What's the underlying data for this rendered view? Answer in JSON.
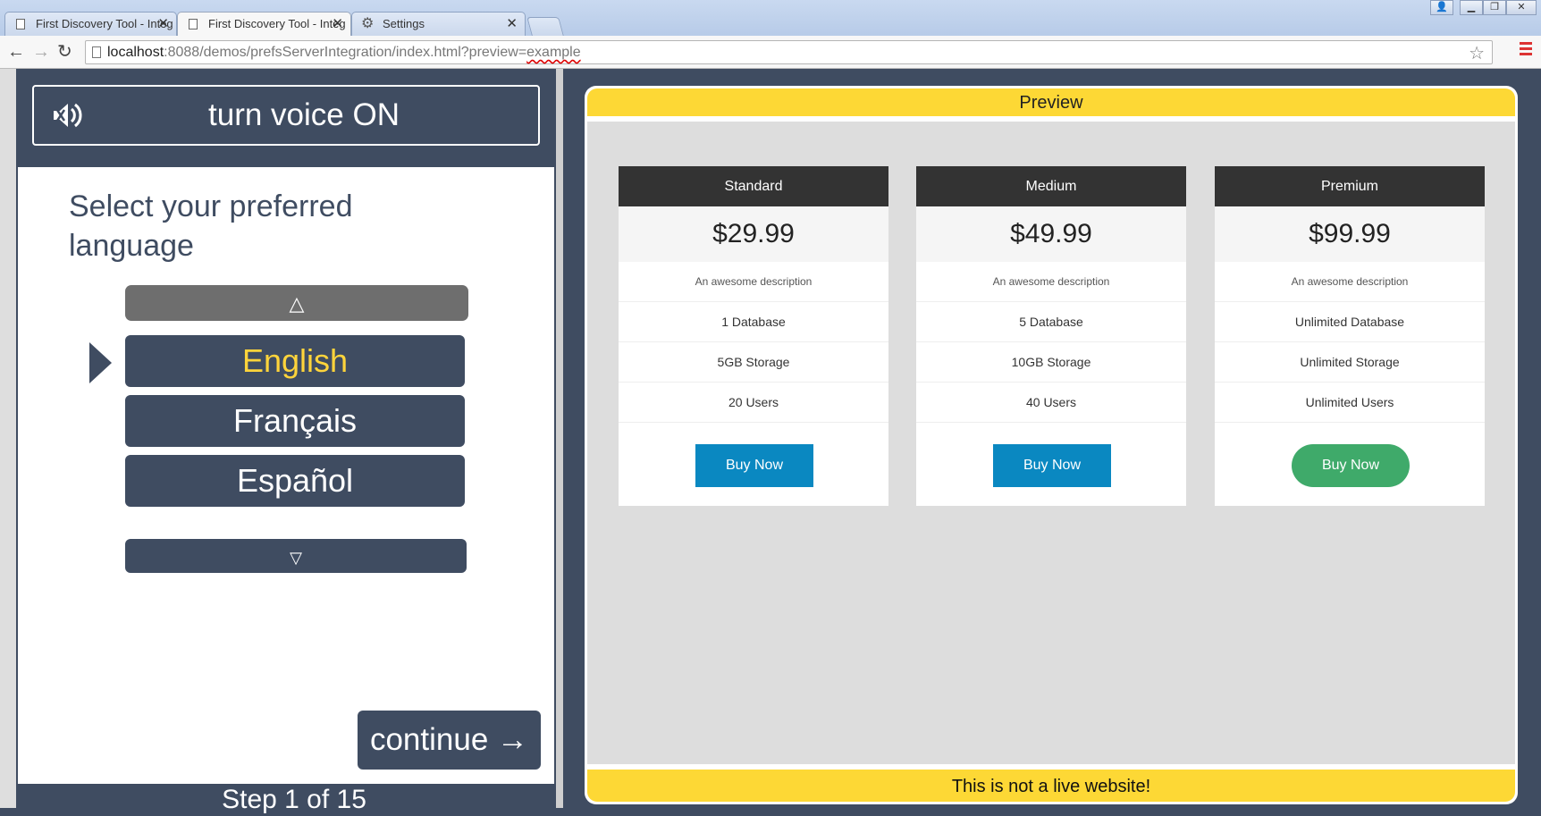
{
  "browser": {
    "tabs": [
      {
        "title": "First Discovery Tool - Integ"
      },
      {
        "title": "First Discovery Tool - Integ"
      },
      {
        "title": "Settings"
      }
    ],
    "url": {
      "host": "localhost",
      "path": ":8088/demos/prefsServerIntegration/index.html?preview=",
      "query": "example"
    }
  },
  "tool": {
    "voice_button": "turn voice ON",
    "prompt": "Select your preferred language",
    "scroll_up": "△",
    "scroll_down": "▽",
    "languages": [
      "English",
      "Français",
      "Español"
    ],
    "selected_language": "English",
    "continue": "continue →",
    "step": "Step 1 of 15"
  },
  "preview": {
    "header": "Preview",
    "footer": "This is not a live website!",
    "plans": [
      {
        "name": "Standard",
        "price": "$29.99",
        "description": "An awesome description",
        "features": [
          "1 Database",
          "5GB Storage",
          "20 Users"
        ],
        "button": "Buy Now"
      },
      {
        "name": "Medium",
        "price": "$49.99",
        "description": "An awesome description",
        "features": [
          "5 Database",
          "10GB Storage",
          "40 Users"
        ],
        "button": "Buy Now"
      },
      {
        "name": "Premium",
        "price": "$99.99",
        "description": "An awesome description",
        "features": [
          "Unlimited Database",
          "Unlimited Storage",
          "Unlimited Users"
        ],
        "button": "Buy Now"
      }
    ]
  },
  "colors": {
    "panel_bg": "#3f4c61",
    "accent_yellow": "#fdd835",
    "buy_blue": "#0a88c1",
    "buy_green": "#3faa6a"
  }
}
